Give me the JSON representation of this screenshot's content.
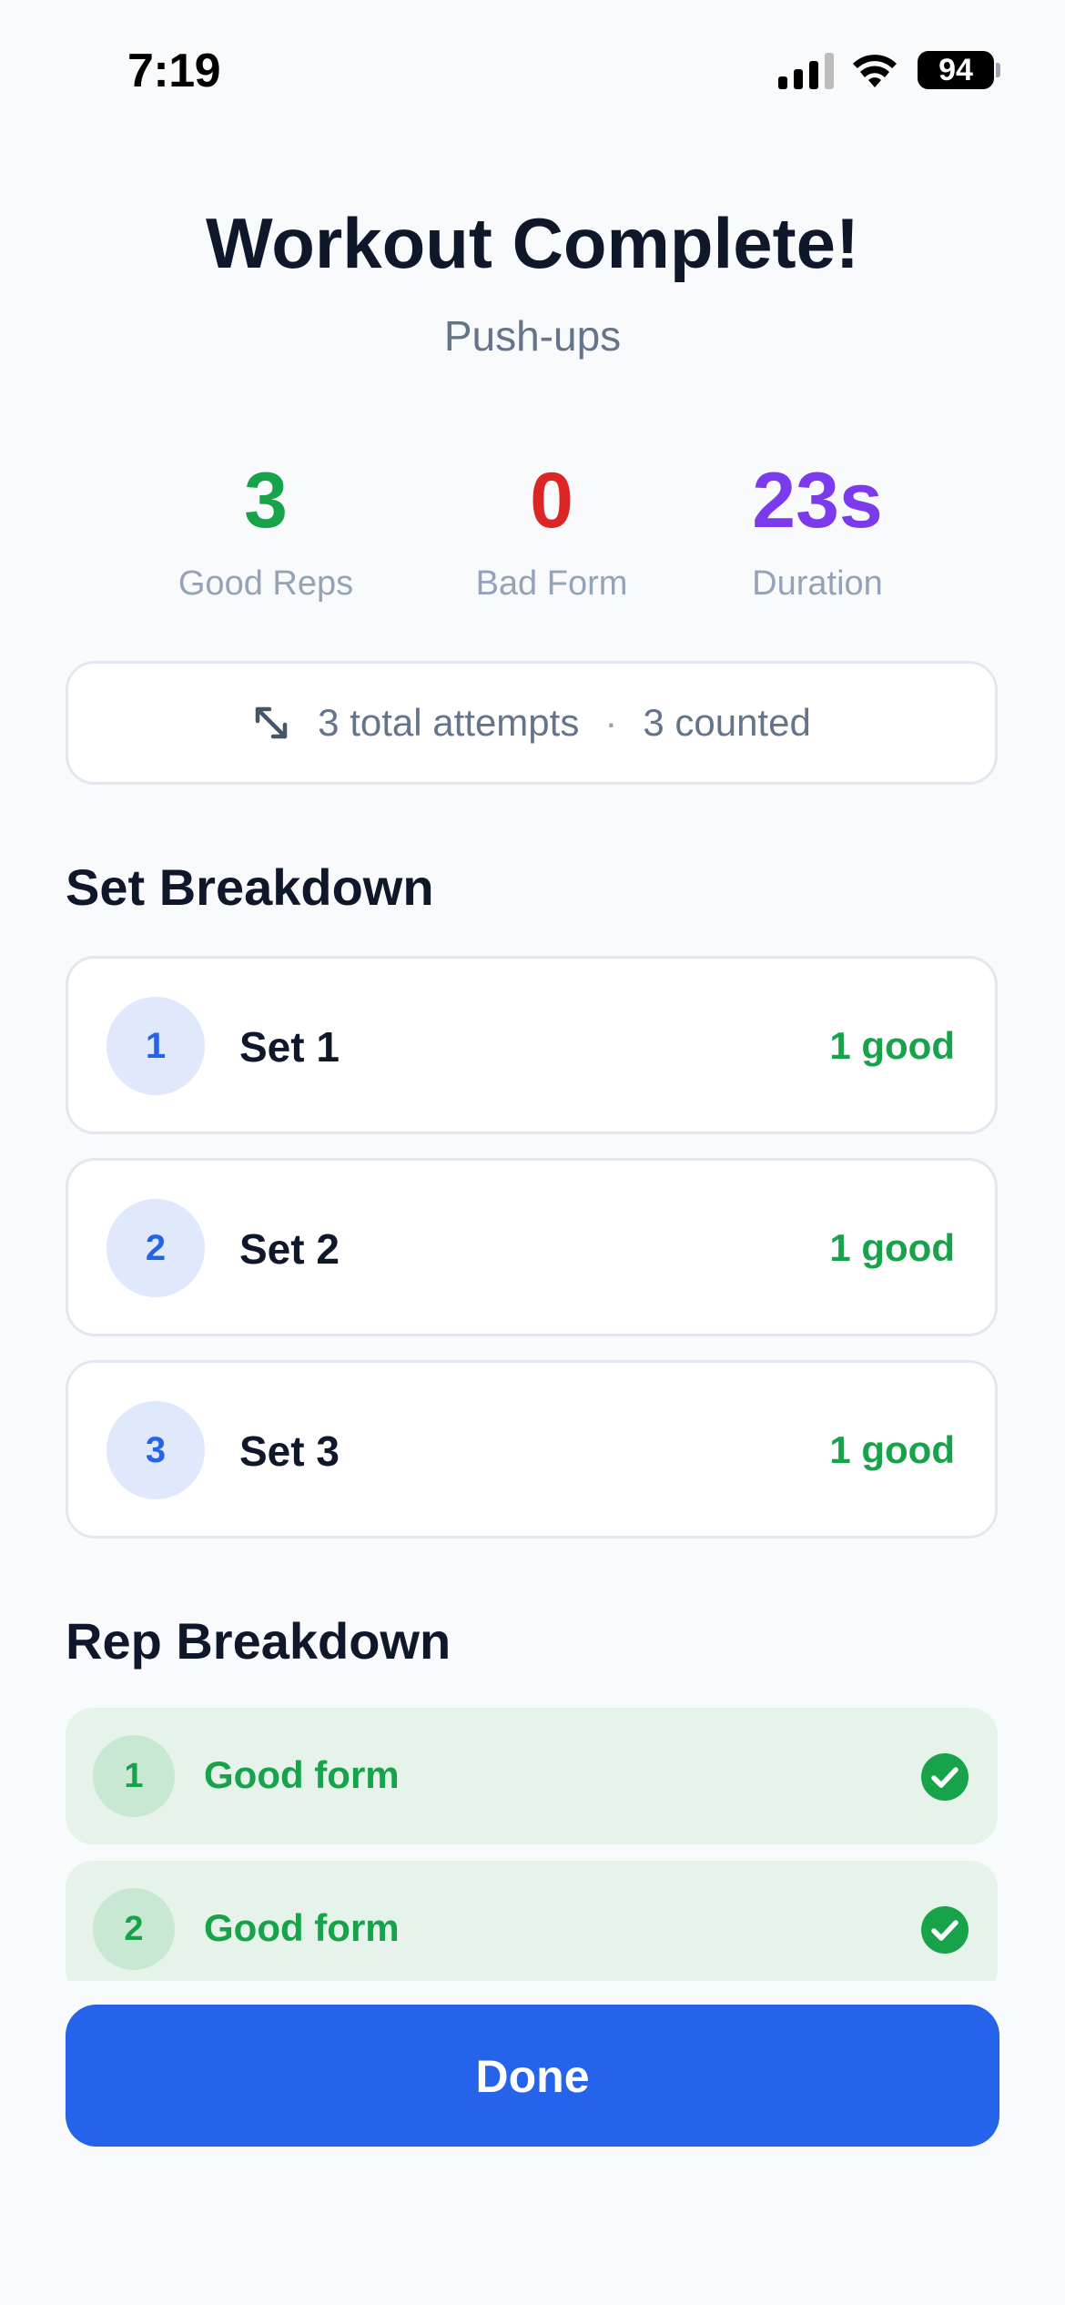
{
  "status_bar": {
    "time": "7:19",
    "battery": "94"
  },
  "header": {
    "title": "Workout Complete!",
    "exercise": "Push-ups"
  },
  "stats": {
    "good_reps": {
      "value": "3",
      "label": "Good Reps",
      "color": "#16A34A"
    },
    "bad_form": {
      "value": "0",
      "label": "Bad Form",
      "color": "#DC2626"
    },
    "duration": {
      "value": "23s",
      "label": "Duration",
      "color": "#7C3AED"
    }
  },
  "attempts": {
    "total": "3 total attempts",
    "separator": "·",
    "counted": "3 counted"
  },
  "set_breakdown": {
    "title": "Set Breakdown",
    "sets": [
      {
        "number": "1",
        "label": "Set 1",
        "result": "1 good"
      },
      {
        "number": "2",
        "label": "Set 2",
        "result": "1 good"
      },
      {
        "number": "3",
        "label": "Set 3",
        "result": "1 good"
      }
    ]
  },
  "rep_breakdown": {
    "title": "Rep Breakdown",
    "reps": [
      {
        "number": "1",
        "label": "Good form"
      },
      {
        "number": "2",
        "label": "Good form"
      }
    ]
  },
  "actions": {
    "done_label": "Done"
  },
  "colors": {
    "accent": "#2563EB",
    "good": "#16A34A",
    "bad": "#DC2626",
    "duration": "#7C3AED"
  }
}
